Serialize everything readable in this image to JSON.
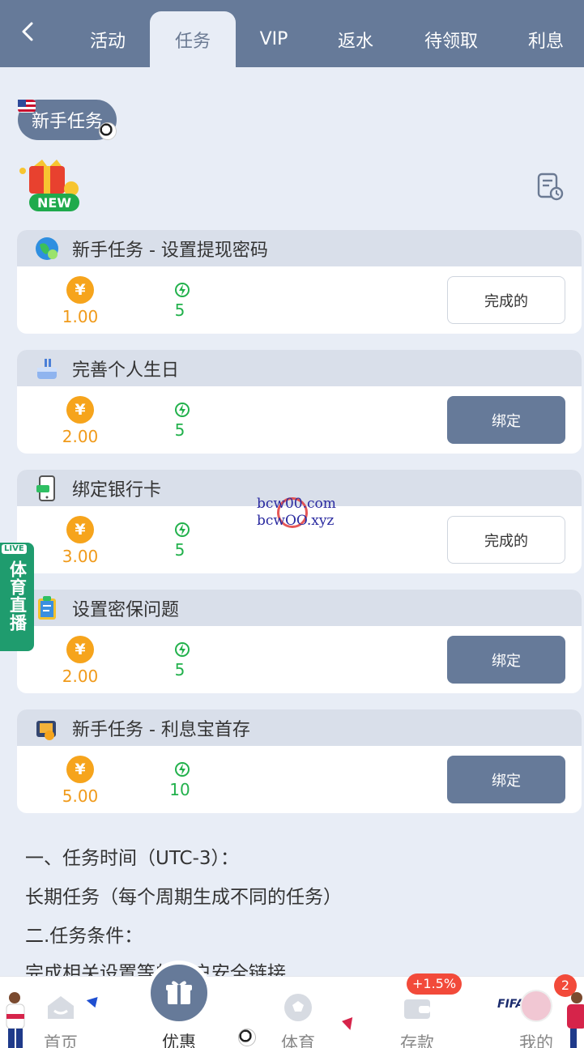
{
  "tabs": [
    {
      "label": "活动"
    },
    {
      "label": "任务"
    },
    {
      "label": "VIP"
    },
    {
      "label": "返水"
    },
    {
      "label": "待领取"
    },
    {
      "label": "利息"
    }
  ],
  "section": {
    "chip_label": "新手任务",
    "new_badge": "NEW"
  },
  "tasks": [
    {
      "title": "新手任务 - 设置提现密码",
      "amount": "1.00",
      "points": "5",
      "button": "完成的",
      "icon": "globe-icon"
    },
    {
      "title": "完善个人生日",
      "amount": "2.00",
      "points": "5",
      "button": "绑定",
      "icon": "cake-icon"
    },
    {
      "title": "绑定银行卡",
      "amount": "3.00",
      "points": "5",
      "button": "完成的",
      "icon": "phone-card-icon"
    },
    {
      "title": "设置密保问题",
      "amount": "2.00",
      "points": "5",
      "button": "绑定",
      "icon": "clipboard-icon"
    },
    {
      "title": "新手任务 - 利息宝首存",
      "amount": "5.00",
      "points": "10",
      "button": "绑定",
      "icon": "wallet-icon"
    }
  ],
  "coin_symbol": "¥",
  "rules": [
    "一、任务时间（UTC-3）：",
    "长期任务（每个周期生成不同的任务）",
    "二.任务条件：",
    "完成相关设置等的账户安全链接"
  ],
  "watermark": {
    "line1": "bcw00.com",
    "line2": "bcwOO.xyz"
  },
  "live_badge": {
    "tag": "LIVE",
    "text": "体育直播"
  },
  "bottom_nav": [
    {
      "label": "首页"
    },
    {
      "label": "优惠"
    },
    {
      "label": "体育"
    },
    {
      "label": "存款"
    },
    {
      "label": "我的"
    }
  ],
  "deposit_badge": "+1.5%",
  "profile_badge": "2",
  "fifa_text": "FIFA",
  "colors": {
    "primary": "#667a99",
    "background": "#e8edf6",
    "coin": "#f6a41c",
    "points": "#22b14c"
  }
}
